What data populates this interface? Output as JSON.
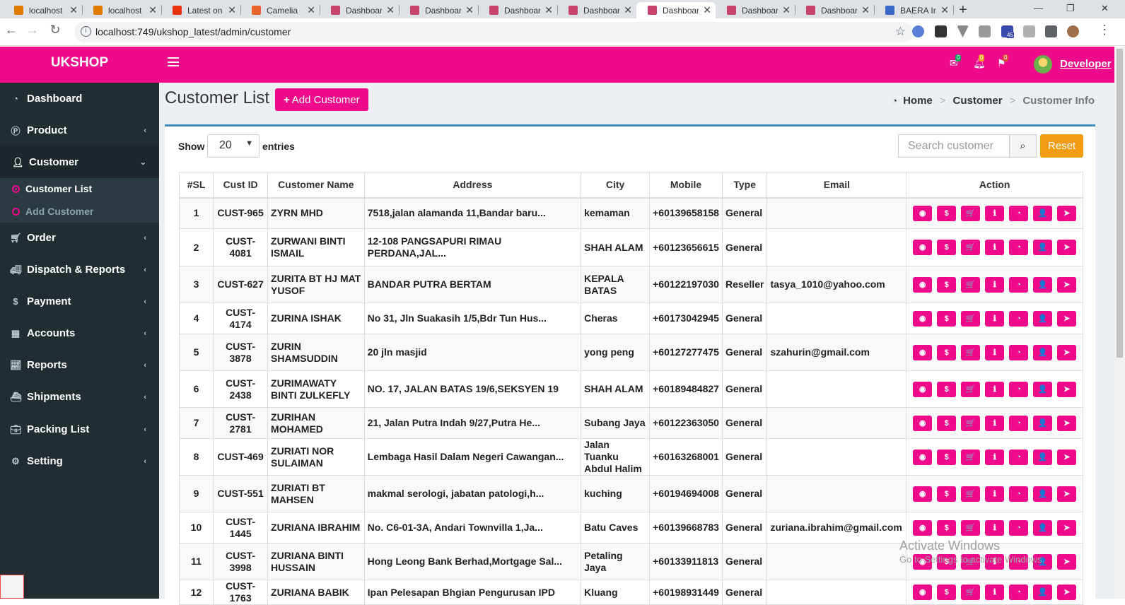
{
  "browser": {
    "tabs": [
      {
        "title": "localhost",
        "favicon": "#e07b00"
      },
      {
        "title": "localhost",
        "favicon": "#e07b00"
      },
      {
        "title": "Latest on",
        "favicon": "#e8320e"
      },
      {
        "title": "Camelia",
        "favicon": "#e8632a"
      },
      {
        "title": "Dashboard",
        "favicon": "#c7436b"
      },
      {
        "title": "Dashboard",
        "favicon": "#c7436b"
      },
      {
        "title": "Dashboard",
        "favicon": "#c7436b"
      },
      {
        "title": "Dashboard",
        "favicon": "#c7436b"
      },
      {
        "title": "Dashboard",
        "favicon": "#c7436b",
        "active": true
      },
      {
        "title": "Dashboard",
        "favicon": "#c7436b"
      },
      {
        "title": "Dashboard",
        "favicon": "#c7436b"
      },
      {
        "title": "BAERA In",
        "favicon": "#3a65c9"
      }
    ],
    "url": "localhost:749/ukshop_latest/admin/customer",
    "ext_badge": "45"
  },
  "topnav": {
    "brand": "UKSHOP",
    "mail_count": "0",
    "bell_count": "0",
    "flag_count": "0",
    "user_name": "Developer"
  },
  "sidebar": {
    "items": [
      {
        "label": "Dashboard",
        "icon": "dashboard-icon"
      },
      {
        "label": "Product",
        "icon": "product-icon"
      },
      {
        "label": "Customer",
        "icon": "user-icon"
      },
      {
        "label": "Order",
        "icon": "cart-icon"
      },
      {
        "label": "Dispatch & Reports",
        "icon": "truck-icon"
      },
      {
        "label": "Payment",
        "icon": "dollar-icon"
      },
      {
        "label": "Accounts",
        "icon": "table-icon"
      },
      {
        "label": "Reports",
        "icon": "chart-icon"
      },
      {
        "label": "Shipments",
        "icon": "ship-icon"
      },
      {
        "label": "Packing List",
        "icon": "briefcase-icon"
      },
      {
        "label": "Setting",
        "icon": "gears-icon"
      }
    ],
    "submenu": [
      "Customer List",
      "Add Customer"
    ]
  },
  "page": {
    "title": "Customer List",
    "add_button": "Add Customer",
    "breadcrumb": [
      "Home",
      "Customer",
      "Customer Info"
    ],
    "show_label": "Show",
    "entries_value": "20",
    "entries_label": "entries",
    "search_placeholder": "Search customer",
    "reset_label": "Reset"
  },
  "table": {
    "headers": [
      "#SL",
      "Cust ID",
      "Customer Name",
      "Address",
      "City",
      "Mobile",
      "Type",
      "Email",
      "Action"
    ],
    "rows": [
      [
        "1",
        "CUST-965",
        "ZYRN MHD",
        "7518,jalan alamanda 11,Bandar baru...",
        "kemaman",
        "+60139658158",
        "General",
        ""
      ],
      [
        "2",
        "CUST-4081",
        "ZURWANI BINTI ISMAIL",
        "12-108 PANGSAPURI RIMAU PERDANA,JAL...",
        "SHAH ALAM",
        "+60123656615",
        "General",
        ""
      ],
      [
        "3",
        "CUST-627",
        "ZURITA BT HJ MAT YUSOF",
        "BANDAR PUTRA BERTAM",
        "KEPALA BATAS",
        "+60122197030",
        "Reseller",
        "tasya_1010@yahoo.com"
      ],
      [
        "4",
        "CUST-4174",
        "ZURINA ISHAK",
        "No 31, Jln Suakasih 1/5,Bdr Tun Hus...",
        "Cheras",
        "+60173042945",
        "General",
        ""
      ],
      [
        "5",
        "CUST-3878",
        "ZURIN SHAMSUDDIN",
        "20 jln masjid",
        "yong peng",
        "+60127277475",
        "General",
        "szahurin@gmail.com"
      ],
      [
        "6",
        "CUST-2438",
        "ZURIMAWATY BINTI ZULKEFLY",
        "NO. 17, JALAN BATAS 19/6,SEKSYEN 19",
        "SHAH ALAM",
        "+60189484827",
        "General",
        ""
      ],
      [
        "7",
        "CUST-2781",
        "ZURIHAN MOHAMED",
        "21, Jalan Putra Indah 9/27,Putra He...",
        "Subang Jaya",
        "+60122363050",
        "General",
        ""
      ],
      [
        "8",
        "CUST-469",
        "ZURIATI NOR SULAIMAN",
        "Lembaga Hasil Dalam Negeri Cawangan...",
        "Jalan Tuanku Abdul Halim",
        "+60163268001",
        "General",
        ""
      ],
      [
        "9",
        "CUST-551",
        "ZURIATI BT MAHSEN",
        "makmal serologi, jabatan patologi,h...",
        "kuching",
        "+60194694008",
        "General",
        ""
      ],
      [
        "10",
        "CUST-1445",
        "ZURIANA IBRAHIM",
        "No. C6-01-3A, Andari Townvilla 1,Ja...",
        "Batu Caves",
        "+60139668783",
        "General",
        "zuriana.ibrahim@gmail.com"
      ],
      [
        "11",
        "CUST-3998",
        "ZURIANA BINTI HUSSAIN",
        "Hong Leong Bank Berhad,Mortgage Sal...",
        "Petaling Jaya",
        "+60133911813",
        "General",
        ""
      ],
      [
        "12",
        "CUST-1763",
        "ZURIANA BABIK",
        "Ipan Pelesapan Bhgian Pengurusan IPD",
        "Kluang",
        "+60198931449",
        "General",
        ""
      ]
    ],
    "actions": [
      {
        "name": "view",
        "glyph": "◉"
      },
      {
        "name": "payment",
        "glyph": "$"
      },
      {
        "name": "orders",
        "glyph": "🛒"
      },
      {
        "name": "info",
        "glyph": "ℹ"
      },
      {
        "name": "dashboard",
        "glyph": "◔"
      },
      {
        "name": "profile",
        "glyph": "👤"
      },
      {
        "name": "send",
        "glyph": "➤"
      }
    ]
  },
  "watermark": {
    "title": "Activate Windows",
    "subtitle": "Go to Settings to activate Windows."
  },
  "colors": {
    "brand": "#ee0a8b",
    "sidebar": "#222d32",
    "accent": "#3c8dbc",
    "reset": "#f39c12"
  }
}
